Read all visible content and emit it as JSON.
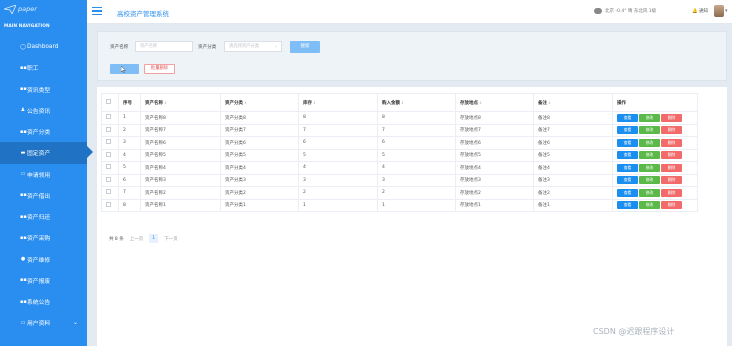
{
  "sidebar": {
    "logo_text": "paper",
    "nav_heading": "MAIN NAVIGATION",
    "items": [
      {
        "label": "Dashboard",
        "icon": "◯"
      },
      {
        "label": "职工",
        "icon": "▪▪"
      },
      {
        "label": "资讯类型",
        "icon": "▪▪"
      },
      {
        "label": "公告资讯",
        "icon": "♟"
      },
      {
        "label": "资产分类",
        "icon": "▪▪"
      },
      {
        "label": "固定资产",
        "icon": "▬"
      },
      {
        "label": "申请领用",
        "icon": "▭"
      },
      {
        "label": "资产借出",
        "icon": "▪▪"
      },
      {
        "label": "资产归还",
        "icon": "▪▪"
      },
      {
        "label": "资产采购",
        "icon": "▪▪"
      },
      {
        "label": "资产维修",
        "icon": "●"
      },
      {
        "label": "资产报废",
        "icon": "▪▪"
      },
      {
        "label": "系统公告",
        "icon": "▪▪"
      },
      {
        "label": "用户资料",
        "icon": "▭"
      }
    ],
    "active_index": 5
  },
  "header": {
    "title": "高校资产管理系统",
    "weather": "北京 -0.4° 晴 东北风 1级",
    "notice": "通知"
  },
  "search": {
    "name_label": "资产名称",
    "name_placeholder": "资产名称",
    "category_label": "资产分类",
    "category_placeholder": "请选择资产分类",
    "search_button": "搜索",
    "add_button": "",
    "batch_delete_button": "批量删除"
  },
  "table": {
    "headers": [
      "序号",
      "资产名称",
      "资产分类",
      "库存",
      "购入金额",
      "存放地点",
      "备注",
      "操作"
    ],
    "rows": [
      {
        "no": "1",
        "name": "资产名称8",
        "category": "资产分类8",
        "stock": "8",
        "amount": "8",
        "location": "存放地点8",
        "remark": "备注8"
      },
      {
        "no": "2",
        "name": "资产名称7",
        "category": "资产分类7",
        "stock": "7",
        "amount": "7",
        "location": "存放地点7",
        "remark": "备注7"
      },
      {
        "no": "3",
        "name": "资产名称6",
        "category": "资产分类6",
        "stock": "6",
        "amount": "6",
        "location": "存放地点6",
        "remark": "备注6"
      },
      {
        "no": "4",
        "name": "资产名称5",
        "category": "资产分类5",
        "stock": "5",
        "amount": "5",
        "location": "存放地点5",
        "remark": "备注5"
      },
      {
        "no": "5",
        "name": "资产名称4",
        "category": "资产分类4",
        "stock": "4",
        "amount": "4",
        "location": "存放地点4",
        "remark": "备注4"
      },
      {
        "no": "6",
        "name": "资产名称3",
        "category": "资产分类3",
        "stock": "3",
        "amount": "3",
        "location": "存放地点3",
        "remark": "备注3"
      },
      {
        "no": "7",
        "name": "资产名称2",
        "category": "资产分类2",
        "stock": "2",
        "amount": "2",
        "location": "存放地点2",
        "remark": "备注2"
      },
      {
        "no": "8",
        "name": "资产名称1",
        "category": "资产分类1",
        "stock": "1",
        "amount": "1",
        "location": "存放地点1",
        "remark": "备注1"
      }
    ],
    "actions": {
      "view": "查看",
      "edit": "修改",
      "delete": "删除"
    }
  },
  "pager": {
    "total": "共 8 条",
    "prev": "上一页",
    "current": "1",
    "next": "下一页"
  },
  "watermark": "CSDN @迟跟程序设计",
  "colors": {
    "sidebar": "#2a8ef0",
    "sidebar_active": "#1f72c4",
    "view": "#1b8ff0",
    "edit": "#5bb94a",
    "delete": "#f26a6a"
  }
}
